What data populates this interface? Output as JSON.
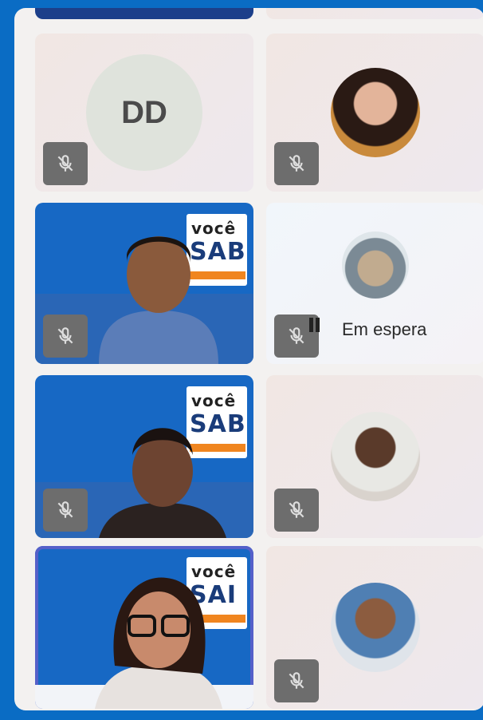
{
  "participants": [
    {
      "initials": "DD",
      "muted": true
    },
    {
      "muted": true
    },
    {
      "muted": true,
      "video": true,
      "brand_line1": "você",
      "brand_line2": "SAB"
    },
    {
      "muted": true,
      "status": "Em espera"
    },
    {
      "muted": true,
      "video": true,
      "brand_line1": "você",
      "brand_line2": "SAB"
    },
    {
      "muted": true
    },
    {
      "muted": false,
      "video": true,
      "speaking": true,
      "brand_line1": "você",
      "brand_line2": "SAI"
    },
    {
      "muted": true
    }
  ],
  "colors": {
    "background": "#0a6cc4",
    "speaking_outline": "#5560c9",
    "mic_badge": "#6d6d6d"
  },
  "icons": {
    "mic": "mic-off-icon",
    "hold": "pause-icon"
  }
}
